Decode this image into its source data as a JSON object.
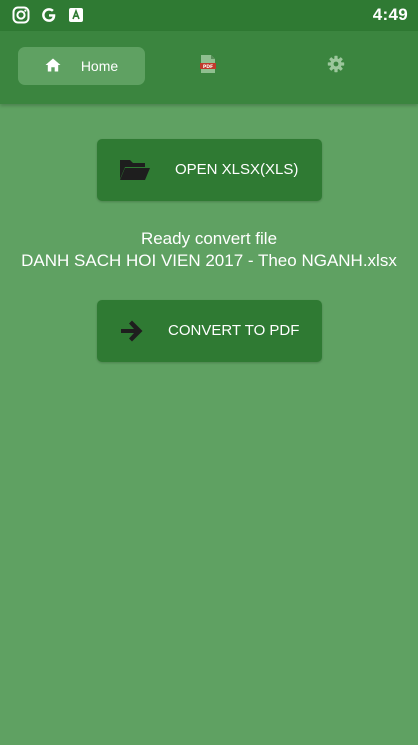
{
  "status_bar": {
    "time": "4:49",
    "icons": [
      "instagram-icon",
      "google-icon",
      "app-notification-icon"
    ]
  },
  "tabs": [
    {
      "label": "Home",
      "icon": "home-icon",
      "selected": true
    },
    {
      "label": "",
      "icon": "pdf-file-icon",
      "selected": false
    },
    {
      "label": "",
      "icon": "gear-icon",
      "selected": false
    }
  ],
  "main": {
    "open_button_label": "OPEN XLSX(XLS)",
    "status_line1": "Ready convert file",
    "status_line2": "DANH SACH HOI VIEN 2017 - Theo NGANH.xlsx",
    "convert_button_label": "CONVERT TO PDF"
  },
  "colors": {
    "background": "#5fa162",
    "app_bar": "#3b853f",
    "status_bar": "#2f7a33",
    "button": "#2f7a33",
    "text": "#ffffff"
  }
}
